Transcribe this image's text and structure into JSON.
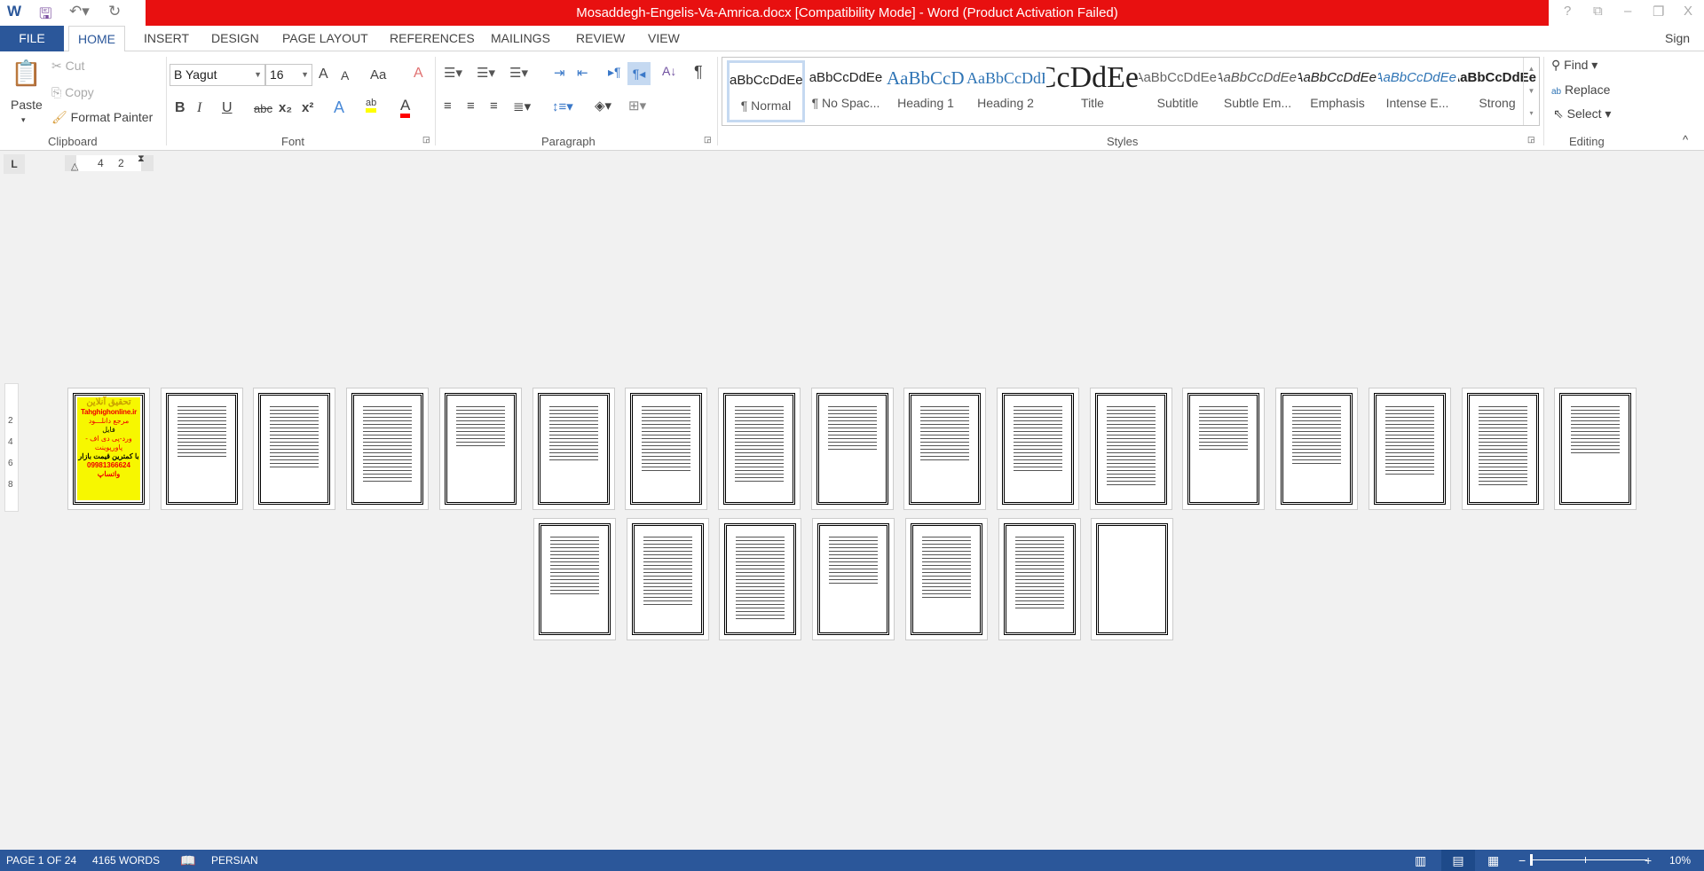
{
  "title_bar": {
    "title": "Mosaddegh-Engelis-Va-Amrica.docx [Compatibility Mode] -  Word (Product Activation Failed)",
    "help": "?",
    "restore": "⧉",
    "minimize": "–",
    "maximize": "❐",
    "close": "X"
  },
  "tabs": [
    "FILE",
    "HOME",
    "INSERT",
    "DESIGN",
    "PAGE LAYOUT",
    "REFERENCES",
    "MAILINGS",
    "REVIEW",
    "VIEW"
  ],
  "sign_in": "Sign in",
  "clipboard": {
    "paste": "Paste",
    "cut": "Cut",
    "copy": "Copy",
    "format_painter": "Format Painter",
    "label": "Clipboard"
  },
  "font": {
    "name": "B Yagut",
    "size": "16",
    "label": "Font",
    "grow": "A",
    "shrink": "A",
    "case": "Aa",
    "bold": "B",
    "italic": "I",
    "underline": "U",
    "strike": "abc",
    "sub": "x₂",
    "sup": "x²",
    "effects": "A",
    "highlight": "ab",
    "color": "A",
    "highlight_color": "#ffff00",
    "font_color": "#ff0000"
  },
  "paragraph": {
    "label": "Paragraph",
    "sort": "A↓",
    "pilcrow": "¶"
  },
  "styles": {
    "label": "Styles",
    "items": [
      {
        "preview": "aBbCcDdEe",
        "name": "¶ Normal"
      },
      {
        "preview": "aBbCcDdEe",
        "name": "¶ No Spac..."
      },
      {
        "preview": "AaBbCcDdEe",
        "name": "Heading 1"
      },
      {
        "preview": "AaBbCcDdEe",
        "name": "Heading 2"
      },
      {
        "preview": "AaBbCcDdEe",
        "name": "Title"
      },
      {
        "preview": "AaBbCcDdEe",
        "name": "Subtitle"
      },
      {
        "preview": "AaBbCcDdEe",
        "name": "Subtle Em..."
      },
      {
        "preview": "AaBbCcDdEe",
        "name": "Emphasis"
      },
      {
        "preview": "AaBbCcDdEe",
        "name": "Intense E..."
      },
      {
        "preview": "AaBbCcDdEe",
        "name": "Strong"
      }
    ]
  },
  "editing": {
    "find": "Find",
    "replace": "Replace",
    "select": "Select",
    "label": "Editing"
  },
  "ruler": {
    "tab_selector": "L",
    "marks": [
      "4",
      "2"
    ]
  },
  "vruler": [
    "2",
    "4",
    "6",
    "8"
  ],
  "cover_ad": {
    "title": "تحقیق آنلاین",
    "site": "Tahghighonline.ir",
    "line1": "مرجع دانلـــود",
    "line2": "فایل",
    "line3": "ورد-پی دی اف - پاورپوینت",
    "line4": "با کمترین قیمت بازار",
    "line5": "09981366624 واتساپ"
  },
  "document": {
    "page_count": 24,
    "row1_pages": 17,
    "zoom_percent": 10
  },
  "status": {
    "page": "PAGE 1 OF 24",
    "words": "4165 WORDS",
    "language": "PERSIAN",
    "zoom": "10%"
  }
}
